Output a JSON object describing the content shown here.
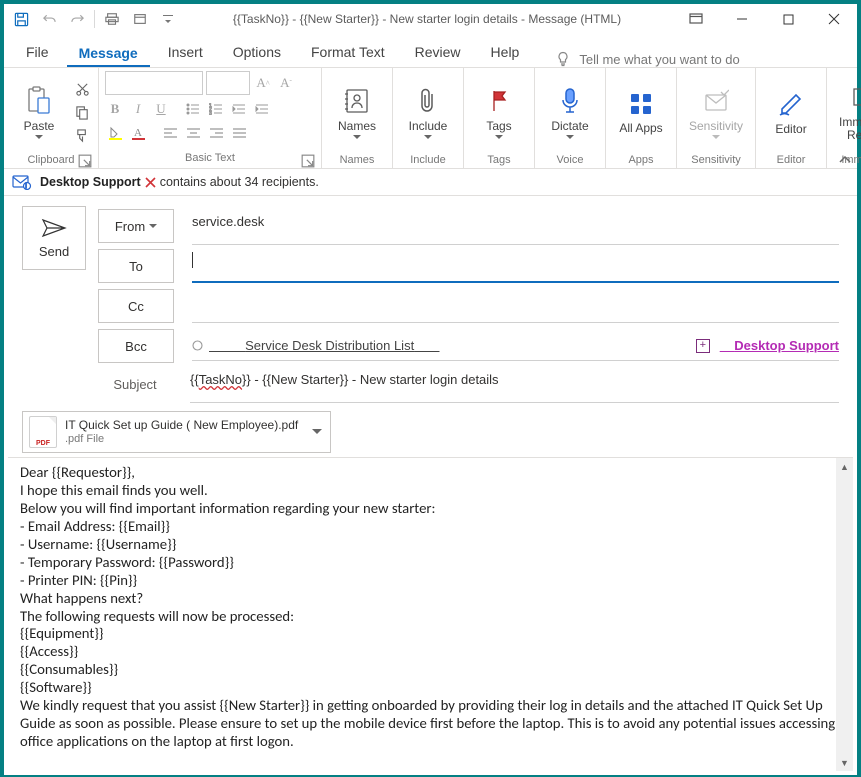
{
  "titlebar": {
    "title": "{{TaskNo}} - {{New Starter}} - New starter login details - Message (HTML)"
  },
  "tabs": {
    "file": "File",
    "message": "Message",
    "insert": "Insert",
    "options": "Options",
    "format": "Format Text",
    "review": "Review",
    "help": "Help",
    "tellme": "Tell me what you want to do"
  },
  "ribbon": {
    "clipboard": {
      "label": "Clipboard",
      "paste": "Paste"
    },
    "basictext": {
      "label": "Basic Text"
    },
    "names": {
      "label": "Names",
      "btn": "Names"
    },
    "include": {
      "label": "Include",
      "btn": "Include"
    },
    "tags": {
      "label": "Tags",
      "btn": "Tags"
    },
    "voice": {
      "label": "Voice",
      "btn": "Dictate"
    },
    "apps": {
      "label": "Apps",
      "btn": "All Apps"
    },
    "sensitivity": {
      "label": "Sensitivity",
      "btn": "Sensitivity"
    },
    "editor": {
      "label": "Editor",
      "btn": "Editor"
    },
    "immersive": {
      "label": "Immersive",
      "btn": "Immersive Reader"
    }
  },
  "infobar": {
    "group": "Desktop Support",
    "text": " contains about 34 recipients."
  },
  "compose": {
    "send": "Send",
    "from_label": "From",
    "from_value": "service.desk",
    "to_label": "To",
    "to_value": "",
    "cc_label": "Cc",
    "cc_value": "",
    "bcc_label": "Bcc",
    "bcc_recip_prefix": "          ",
    "bcc_recip": "Service Desk Distribution List",
    "bcc_recip_suffix": "       ",
    "bcc_link": "Desktop Support",
    "subject_label": "Subject",
    "subject_value_pre": "{{",
    "subject_value_task": "TaskNo",
    "subject_value_post": "}} -  {{New Starter}} - New starter login details"
  },
  "attachment": {
    "name": "IT Quick Set up Guide ( New Employee).pdf",
    "sub": ".pdf File"
  },
  "body": {
    "l1": "Dear {{Requestor}},",
    "l2": "",
    "l3": "I hope this email finds you well.",
    "l4": "Below you will find important information regarding your new starter:",
    "l5": "- Email Address: {{Email}}",
    "l6": "- Username: {{Username}}",
    "l7": "- Temporary Password:  {{Password}}",
    "l8": "- Printer PIN:   {{Pin}}",
    "l9": "",
    "l10": "What happens next?",
    "l11": "The following requests will now be processed:",
    "l12": "{{Equipment}}",
    "l13": "{{Access}}",
    "l14": "{{Consumables}}",
    "l15": "{{Software}}",
    "l16": "We kindly request that you assist {{New Starter}} in getting onboarded by providing their log in details and the attached IT Quick Set Up Guide as soon as possible. Please ensure to set up the mobile device first before the laptop. This is to avoid any potential issues accessing office applications on the laptop at first logon."
  }
}
